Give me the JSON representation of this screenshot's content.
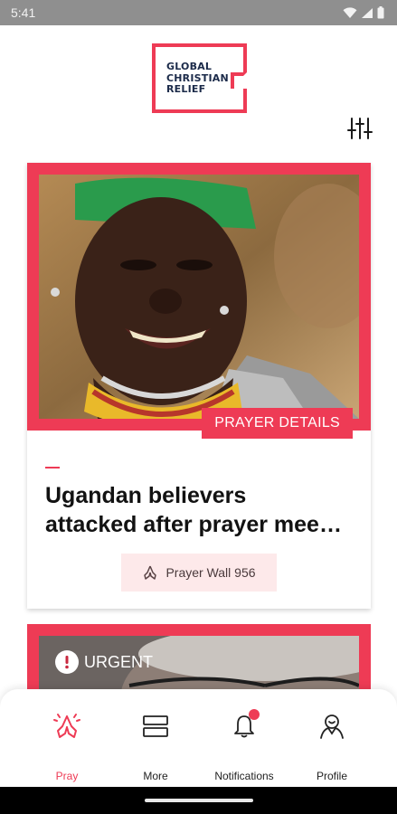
{
  "status_bar": {
    "time": "5:41"
  },
  "header": {
    "logo_lines": [
      "GLOBAL",
      "CHRISTIAN",
      "RELIEF"
    ],
    "filter_icon": "sliders-icon"
  },
  "feed": {
    "cards": [
      {
        "badge_label": "PRAYER DETAILS",
        "title_lines": [
          "Ugandan believers",
          "attacked after prayer mee…"
        ],
        "prayer_wall_label": "Prayer Wall 956",
        "prayer_wall_icon": "praying-hands-icon"
      },
      {
        "urgent_label": "URGENT",
        "urgent_icon": "exclamation-icon"
      }
    ]
  },
  "bottom_nav": {
    "items": [
      {
        "label": "Pray",
        "icon": "praying-hands-icon",
        "active": true
      },
      {
        "label": "More",
        "icon": "stack-icon",
        "active": false
      },
      {
        "label": "Notifications",
        "icon": "bell-icon",
        "active": false,
        "has_badge": true
      },
      {
        "label": "Profile",
        "icon": "profile-icon",
        "active": false
      }
    ]
  },
  "colors": {
    "accent": "#ee3b55",
    "accent_light": "#fde9ea",
    "logo_navy": "#1c2b4a",
    "status_bar": "#8f8f8f"
  }
}
